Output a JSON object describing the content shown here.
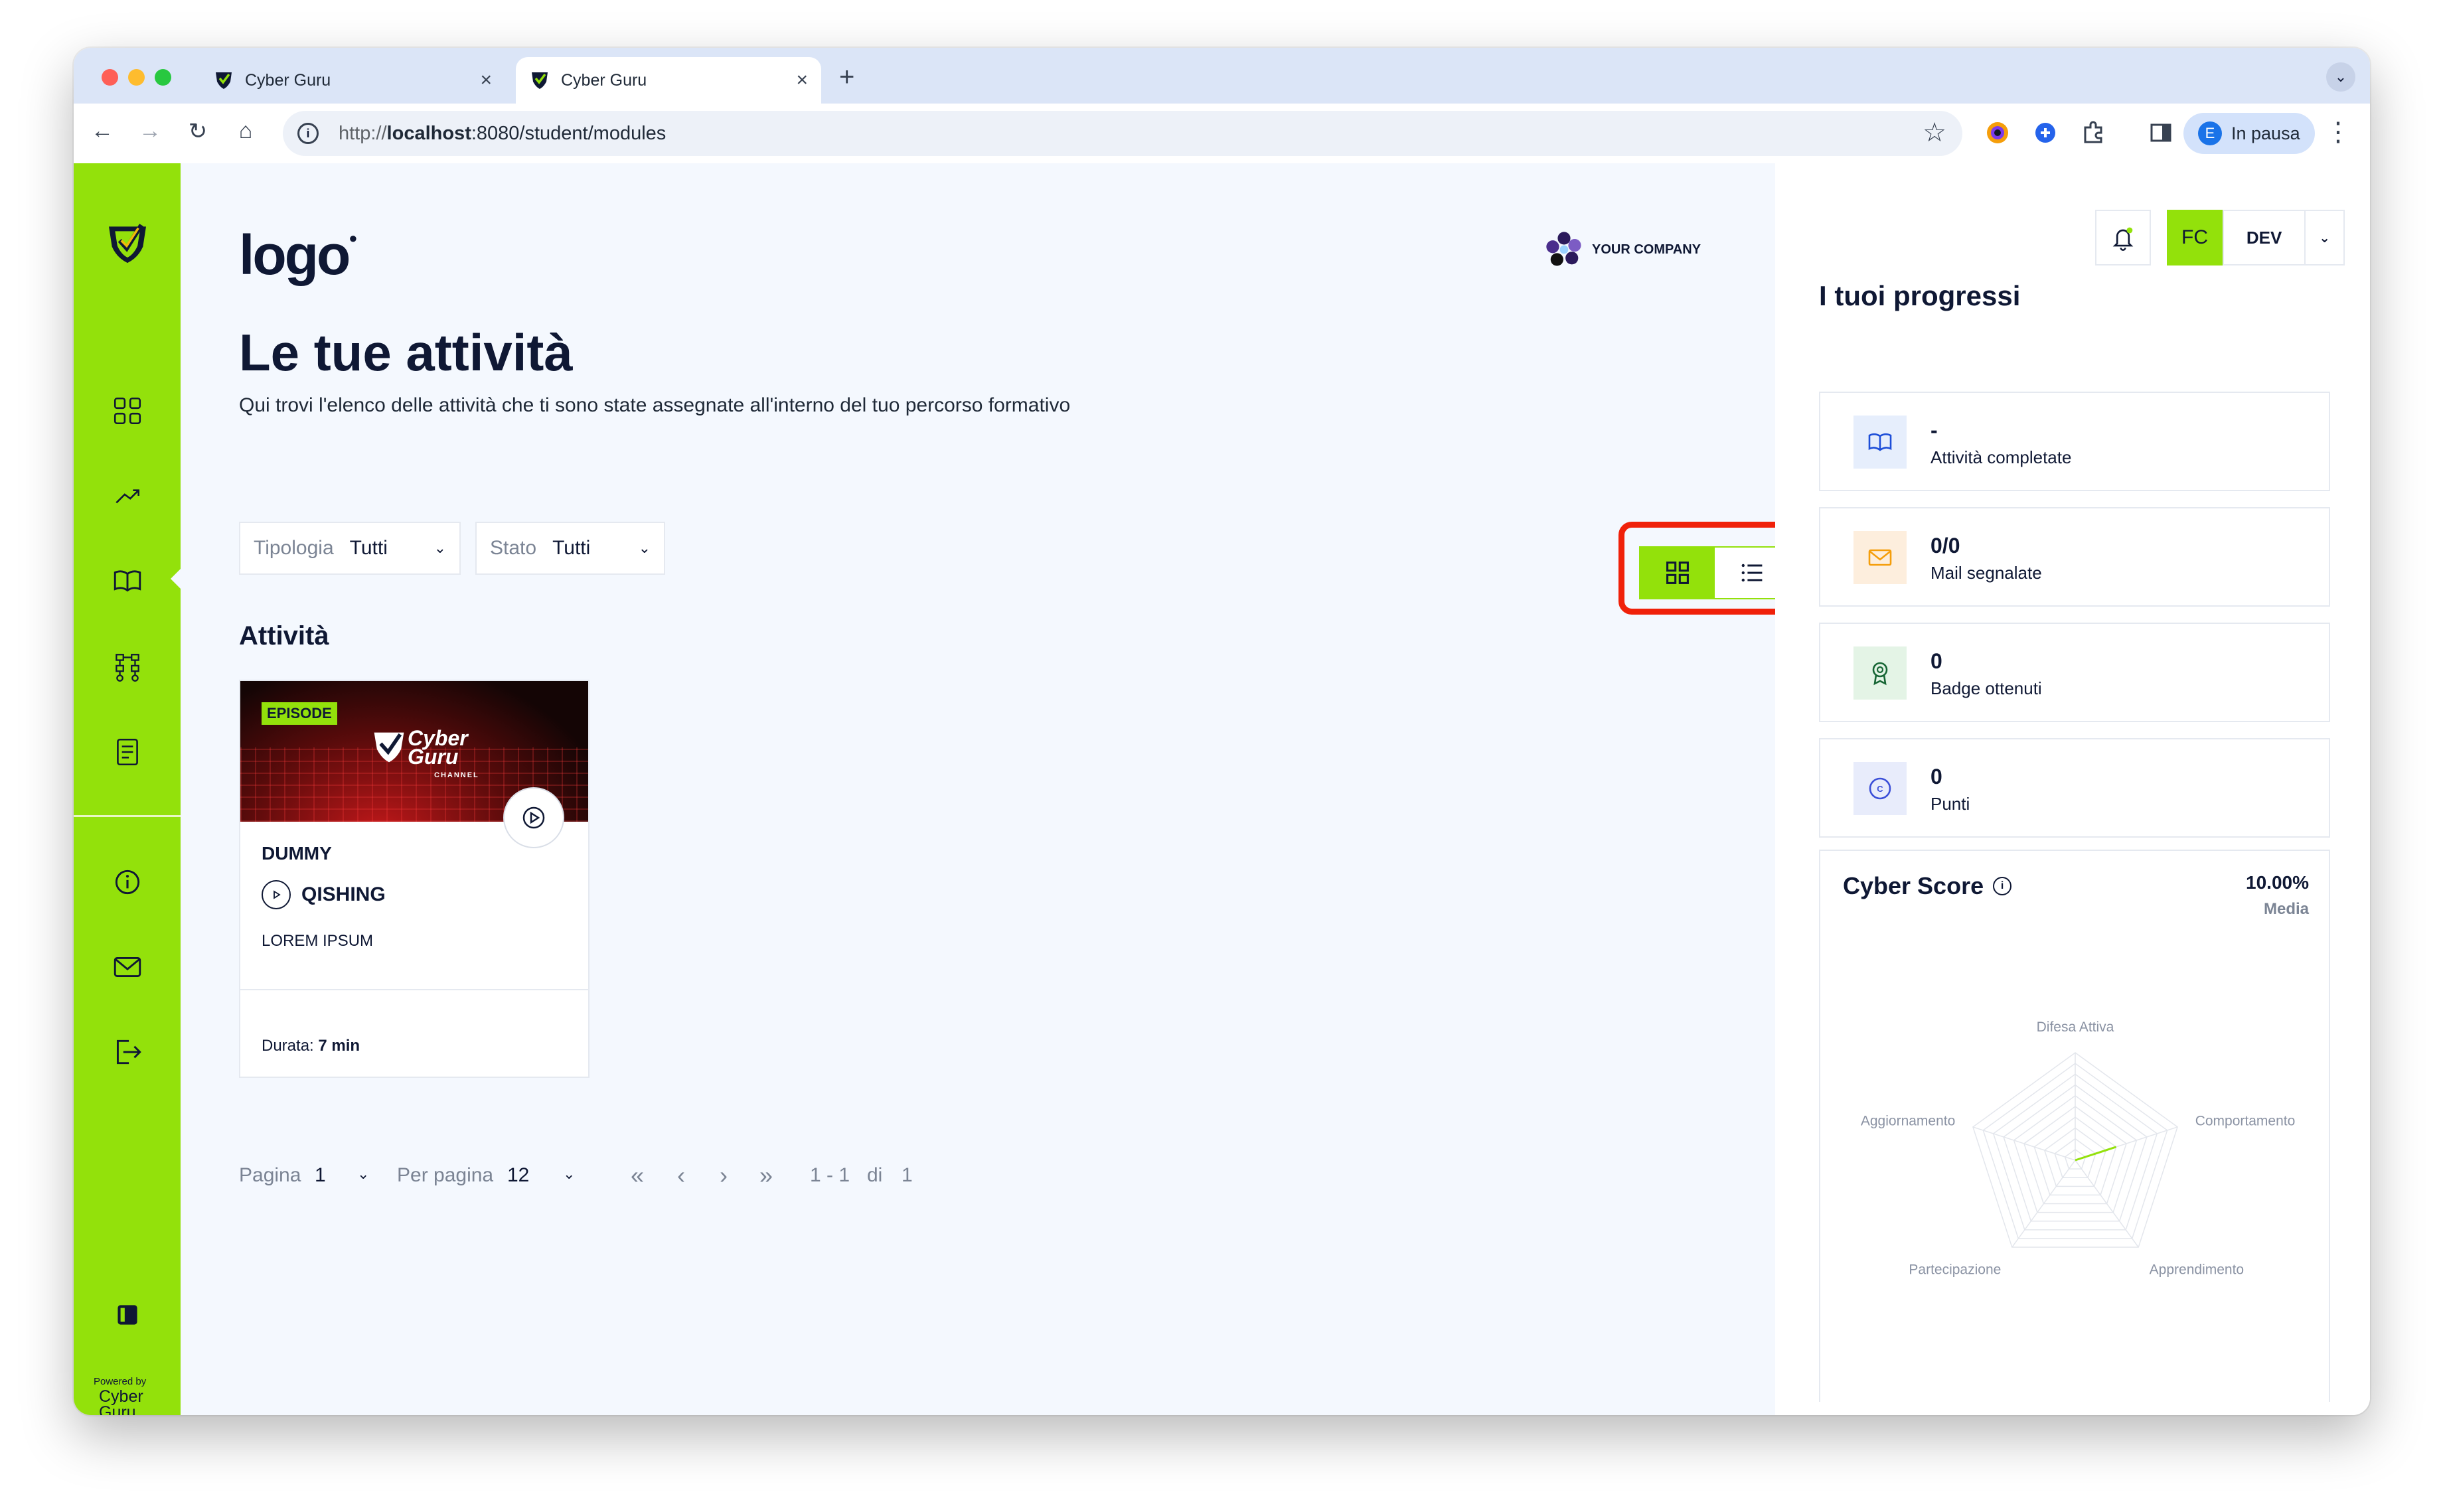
{
  "browser": {
    "tabs": [
      {
        "title": "Cyber Guru"
      },
      {
        "title": "Cyber Guru"
      }
    ],
    "new_tab": "+",
    "url_prefix": "http://",
    "url_host": "localhost",
    "url_rest": ":8080/student/modules",
    "profile_initial": "E",
    "profile_status": "In pausa"
  },
  "sidebar": {
    "items": [
      {
        "icon": "grid-icon"
      },
      {
        "icon": "trend-up-icon"
      },
      {
        "icon": "book-icon"
      },
      {
        "icon": "network-icon"
      },
      {
        "icon": "document-icon"
      },
      {
        "icon": "info-icon"
      },
      {
        "icon": "mail-icon"
      },
      {
        "icon": "logout-icon"
      },
      {
        "icon": "panel-toggle-icon"
      }
    ],
    "powered_by": "Powered by",
    "powered_name_1": "Cyber",
    "powered_name_2": "Guru"
  },
  "main": {
    "logo_text": "logo",
    "company": "YOUR COMPANY",
    "title": "Le tue attività",
    "subtitle": "Qui trovi l'elenco delle attività che ti sono state assegnate all'interno del tuo percorso formativo",
    "filters": [
      {
        "label": "Tipologia",
        "value": "Tutti"
      },
      {
        "label": "Stato",
        "value": "Tutti"
      }
    ],
    "section_title": "Attività",
    "card": {
      "badge": "EPISODE",
      "brand_1": "Cyber",
      "brand_2": "Guru",
      "brand_sub": "CHANNEL",
      "title": "DUMMY",
      "type": "QISHING",
      "desc": "LOREM IPSUM",
      "duration_label": "Durata:",
      "duration_value": "7 min"
    },
    "pagination": {
      "page_label": "Pagina",
      "page_value": "1",
      "per_page_label": "Per pagina",
      "per_page_value": "12",
      "first": "«",
      "prev": "‹",
      "next": "›",
      "last": "»",
      "range": "1 - 1",
      "of": "di",
      "total": "1"
    }
  },
  "right": {
    "user_initials": "FC",
    "env": "DEV",
    "title": "I tuoi progressi",
    "stats": [
      {
        "value": "-",
        "label": "Attività completate",
        "icon": "book-icon",
        "color": "#e6eefc"
      },
      {
        "value": "0/0",
        "label": "Mail segnalate",
        "icon": "mail-icon",
        "color": "#fdeedd"
      },
      {
        "value": "0",
        "label": "Badge ottenuti",
        "icon": "award-icon",
        "color": "#e4f4e6"
      },
      {
        "value": "0",
        "label": "Punti",
        "icon": "coin-icon",
        "color": "#e8ecfb"
      }
    ],
    "score": {
      "title": "Cyber Score",
      "percent": "10.00%",
      "media": "Media",
      "axes": [
        "Difesa Attiva",
        "Comportamento",
        "Apprendimento",
        "Partecipazione",
        "Aggiornamento"
      ],
      "values": [
        0,
        0.4,
        0,
        0,
        0
      ]
    }
  },
  "colors": {
    "accent": "#93e10b",
    "highlight": "#f0210a",
    "text": "#0f1834"
  }
}
